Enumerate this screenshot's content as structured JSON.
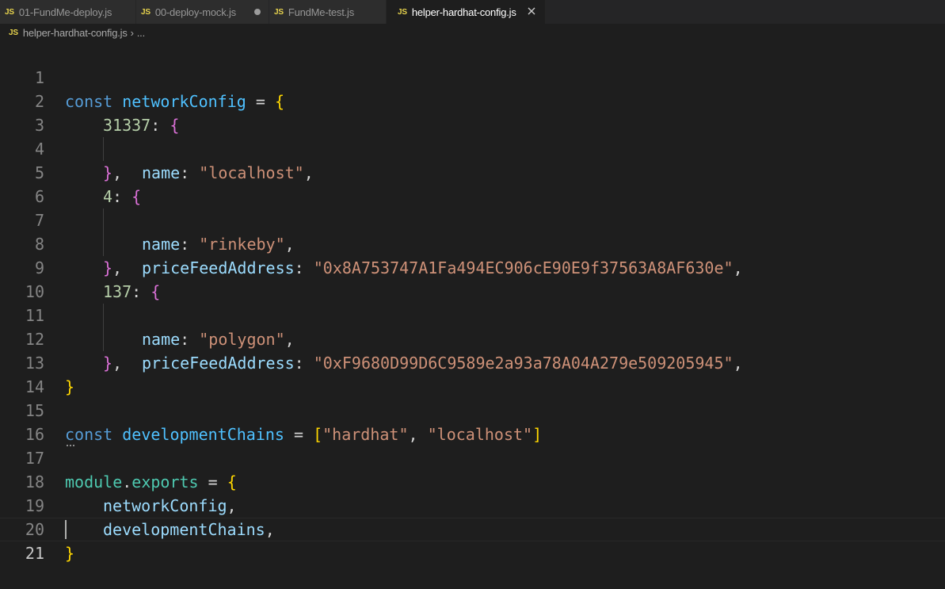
{
  "tabs": [
    {
      "label": "01-FundMe-deploy.js",
      "icon": "JS",
      "active": false,
      "modified": false
    },
    {
      "label": "00-deploy-mock.js",
      "icon": "JS",
      "active": false,
      "modified": true
    },
    {
      "label": "FundMe-test.js",
      "icon": "JS",
      "active": false,
      "modified": false
    },
    {
      "label": "helper-hardhat-config.js",
      "icon": "JS",
      "active": true,
      "modified": false
    }
  ],
  "breadcrumb": {
    "icon": "JS",
    "file": "helper-hardhat-config.js",
    "separator": "›",
    "rest": "..."
  },
  "editor": {
    "current_line": 21,
    "line_numbers": [
      "1",
      "2",
      "3",
      "4",
      "5",
      "6",
      "7",
      "8",
      "9",
      "10",
      "11",
      "12",
      "13",
      "14",
      "15",
      "16",
      "17",
      "18",
      "19",
      "20",
      "21"
    ],
    "tokens": {
      "const": "const",
      "networkConfig": "networkConfig",
      "eq": " = ",
      "open_brace": "{",
      "close_brace": "}",
      "close_brace_comma": "},",
      "colon": ": ",
      "comma": ",",
      "chain_31337": "31337",
      "chain_4": "4",
      "chain_137": "137",
      "name_key": "name",
      "price_key": "priceFeedAddress",
      "str_localhost": "\"localhost\"",
      "str_rinkeby": "\"rinkeby\"",
      "str_polygon": "\"polygon\"",
      "addr_rinkeby": "\"0x8A753747A1Fa494EC906cE90E9f37563A8AF630e\"",
      "addr_polygon": "\"0xF9680D99D6C9589e2a93a78A04A279e509205945\"",
      "developmentChains": "developmentChains",
      "open_bracket": "[",
      "close_bracket": "]",
      "str_hardhat": "\"hardhat\"",
      "comma_space": ", ",
      "module": "module",
      "dot": ".",
      "exports": "exports"
    }
  },
  "colors": {
    "background": "#1e1e1e",
    "keyword": "#569cd6",
    "string": "#ce9178",
    "number": "#b5cea8",
    "property": "#9cdcfe",
    "bracket_level1": "#ffd700",
    "bracket_level2": "#da70d6",
    "js_icon": "#e8d44d"
  },
  "icons": {
    "file_icon": "js-file-icon",
    "modified": "unsaved-dot-icon",
    "close": "close-icon",
    "chevron": "chevron-right-icon"
  }
}
